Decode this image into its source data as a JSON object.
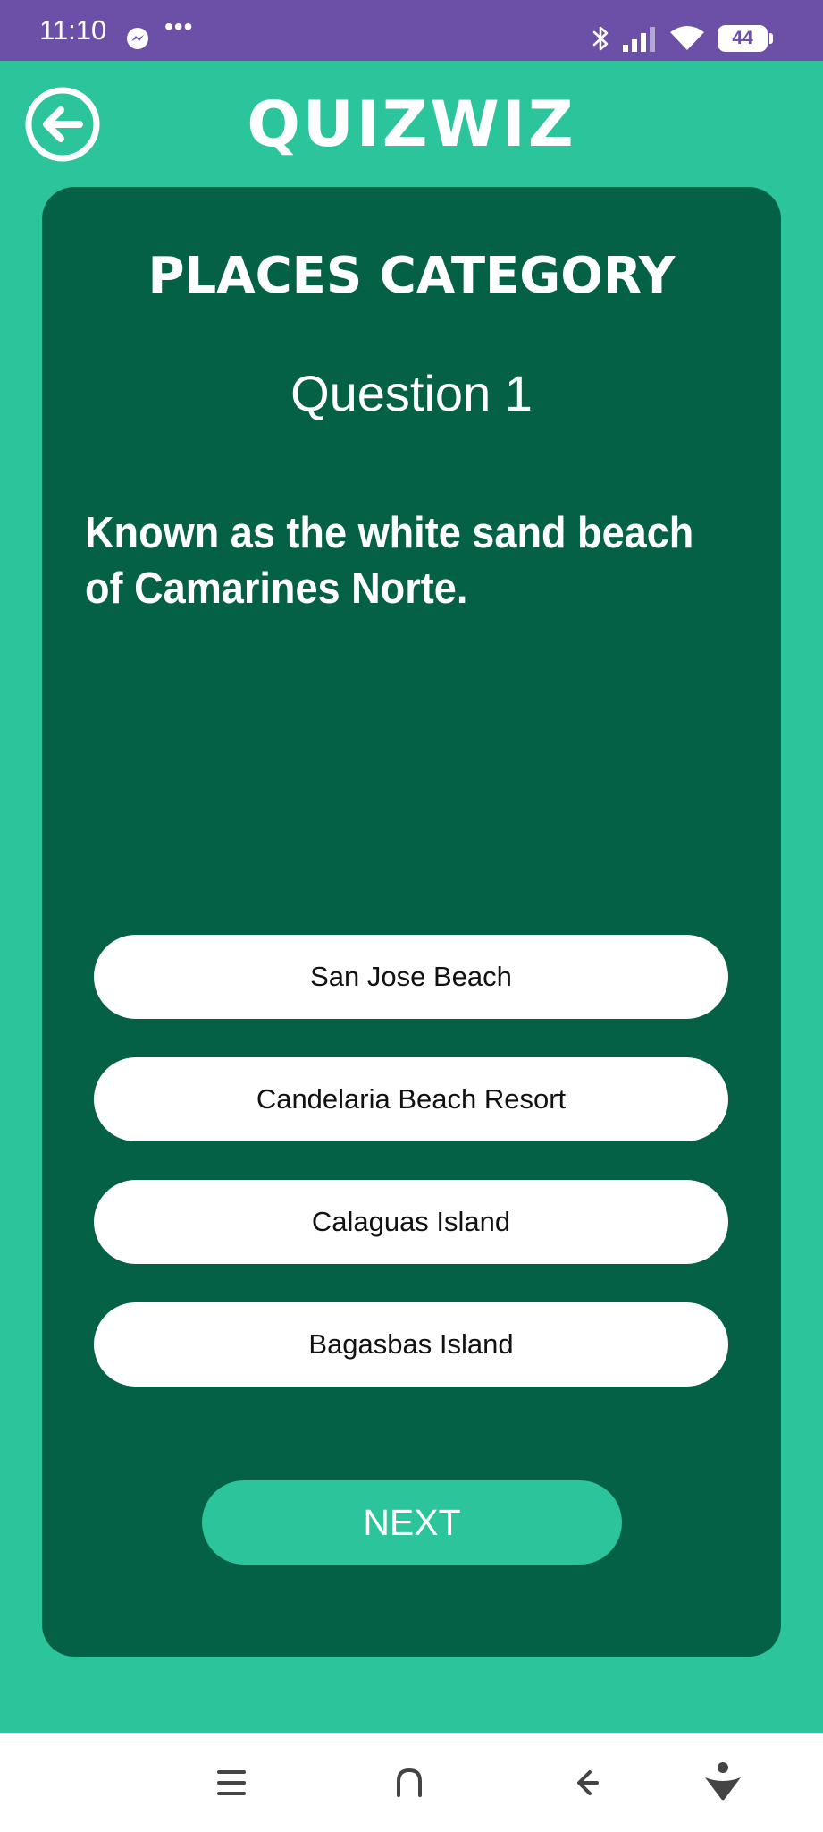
{
  "status_bar": {
    "time": "11:10",
    "more": "•••",
    "battery": "44",
    "icons": [
      "messenger-icon",
      "bluetooth-icon",
      "signal-icon",
      "wifi-icon",
      "battery-icon"
    ]
  },
  "header": {
    "title": "QUIZWIZ",
    "back_icon": "back-arrow-circle-icon"
  },
  "quiz": {
    "category": "PLACES CATEGORY",
    "question_number": "Question 1",
    "question": "Known as the white sand beach of Camarines Norte.",
    "options": [
      "San Jose Beach",
      "Candelaria Beach Resort",
      "Calaguas Island",
      "Bagasbas Island"
    ],
    "next_label": "NEXT"
  },
  "nav_bar": {
    "icons": [
      "menu-icon",
      "home-icon",
      "back-icon",
      "accessibility-icon"
    ]
  },
  "colors": {
    "status_bar": "#6C50A8",
    "background": "#2BC49B",
    "card": "#046146",
    "option_bg": "#FFFFFF",
    "next_button": "#2BC49B"
  }
}
